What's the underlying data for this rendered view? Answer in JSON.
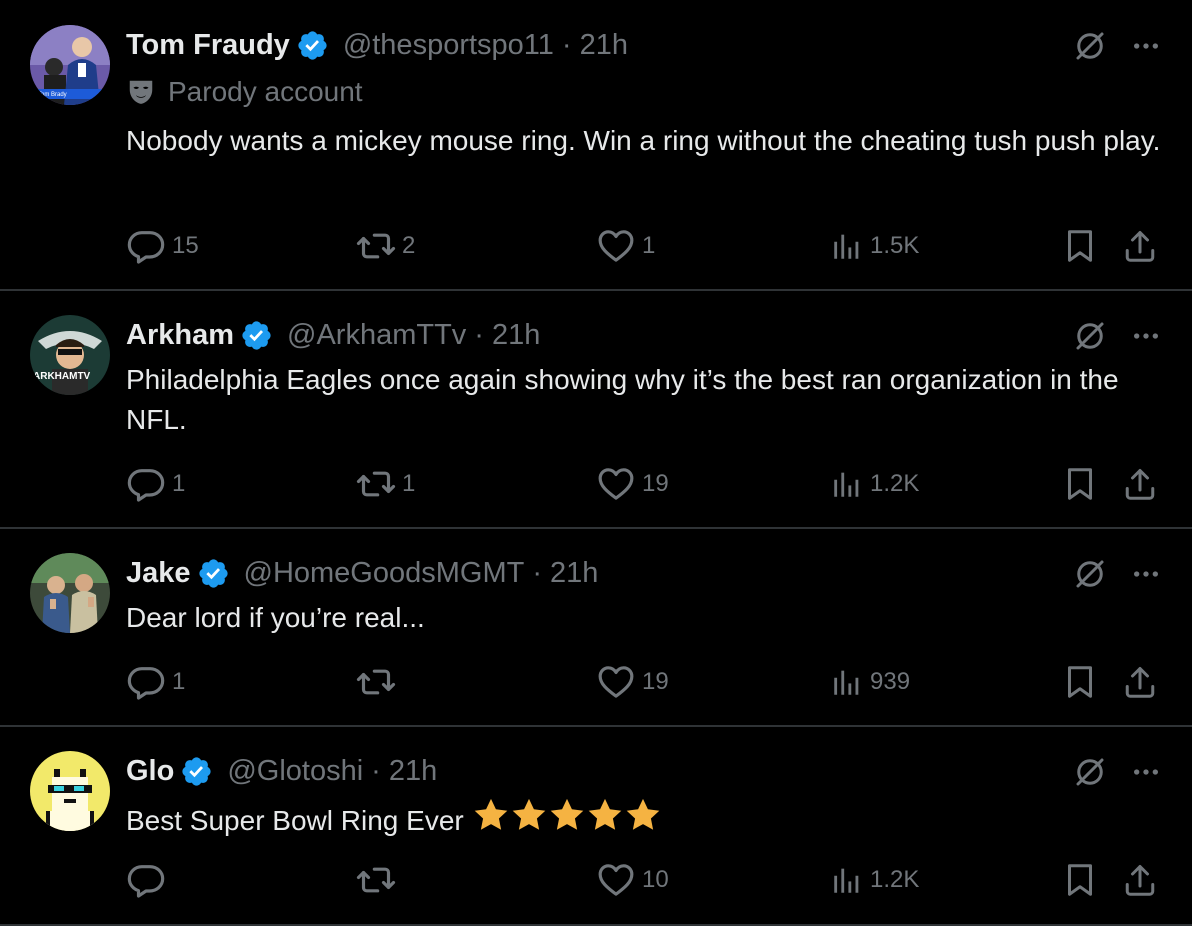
{
  "tweets": [
    {
      "name": "Tom Fraudy",
      "handle": "@thesportspo11",
      "dot": "·",
      "time": "21h",
      "parody_label": "Parody account",
      "text": "Nobody wants a mickey mouse ring. Win a ring without the cheating tush push play.",
      "replies": "15",
      "reposts": "2",
      "likes": "1",
      "views": "1.5K",
      "avatar_caption": "Tom Brady"
    },
    {
      "name": "Arkham",
      "handle": "@ArkhamTTv",
      "dot": "·",
      "time": "21h",
      "text": "Philadelphia Eagles once again showing why it’s the best ran organization in the NFL.",
      "replies": "1",
      "reposts": "1",
      "likes": "19",
      "views": "1.2K",
      "avatar_caption": "ARKHAMTV"
    },
    {
      "name": "Jake",
      "handle": "@HomeGoodsMGMT",
      "dot": "·",
      "time": "21h",
      "text": "Dear lord if you’re real...",
      "replies": "1",
      "reposts": "",
      "likes": "19",
      "views": "939"
    },
    {
      "name": "Glo",
      "handle": "@Glotoshi",
      "dot": "·",
      "time": "21h",
      "text": "Best Super Bowl Ring Ever",
      "emoji": "⭐⭐⭐⭐⭐",
      "replies": "",
      "reposts": "",
      "likes": "10",
      "views": "1.2K"
    }
  ],
  "colors": {
    "background": "#000000",
    "text": "#e7e9ea",
    "secondary": "#71767b",
    "verified": "#1d9bf0",
    "divider": "#2f3336",
    "star": "#f5b342"
  },
  "icons": [
    "verified-badge-icon",
    "grok-slash-icon",
    "more-icon",
    "parody-mask-icon",
    "reply-icon",
    "repost-icon",
    "like-icon",
    "views-icon",
    "bookmark-icon",
    "share-icon"
  ]
}
